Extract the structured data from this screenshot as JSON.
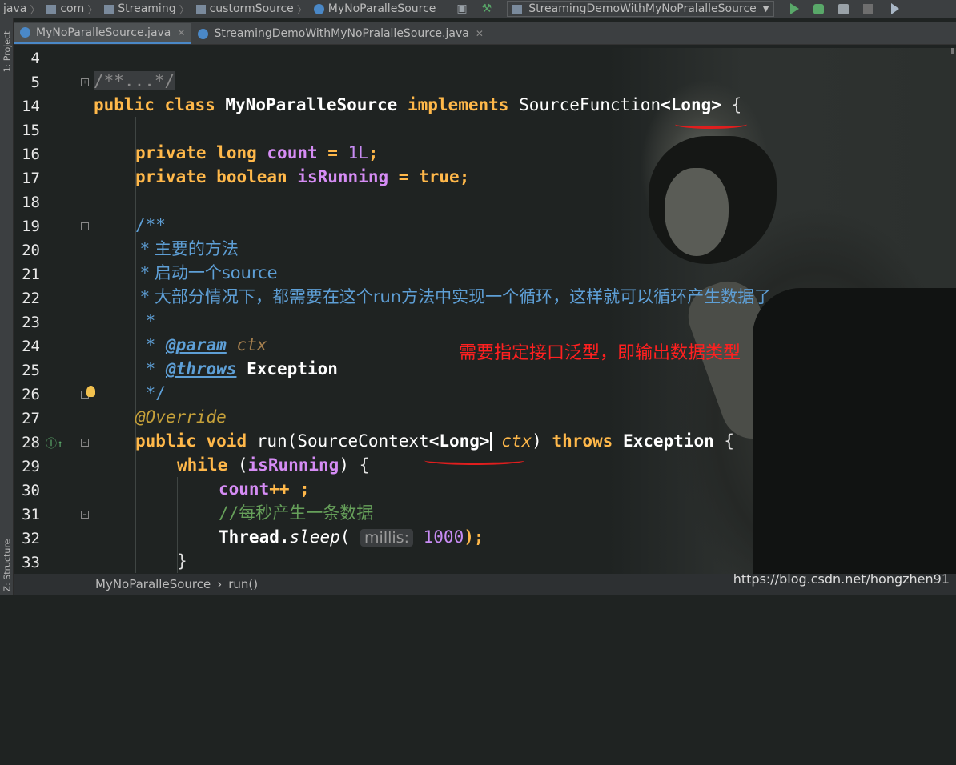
{
  "breadcrumb": [
    "java",
    "com",
    "Streaming",
    "custormSource",
    "MyNoParalleSource"
  ],
  "run_config": "StreamingDemoWithMyNoPralalleSource",
  "side_tools": {
    "project": "1: Project",
    "structure": "Z: Structure"
  },
  "tabs": [
    {
      "label": "MyNoParalleSource.java",
      "active": true
    },
    {
      "label": "StreamingDemoWithMyNoPralalleSource.java",
      "active": false
    }
  ],
  "line_numbers": [
    "4",
    "5",
    "14",
    "15",
    "16",
    "17",
    "18",
    "19",
    "20",
    "21",
    "22",
    "23",
    "24",
    "25",
    "26",
    "27",
    "28",
    "29",
    "30",
    "31",
    "32",
    "33"
  ],
  "code": {
    "l5": "/**...*/",
    "l14_kw1": "public",
    "l14_kw2": "class",
    "l14_name": "MyNoParalleSource",
    "l14_kw3": "implements",
    "l14_iface": "SourceFunction",
    "l14_type": "<Long>",
    "l14_brace": "{",
    "l16_kw1": "private",
    "l16_kw2": "long",
    "l16_field": "count",
    "l16_eq": "=",
    "l16_val": "1L",
    "l16_semi": ";",
    "l17_kw1": "private",
    "l17_kw2": "boolean",
    "l17_field": "isRunning",
    "l17_eq": "=",
    "l17_val": "true",
    "l17_semi": ";",
    "l19": "/**",
    "l20": " * 主要的方法",
    "l21": " * 启动一个source",
    "l22": " * 大部分情况下，都需要在这个run方法中实现一个循环，这样就可以循环产生数据了",
    "l23": " *",
    "l24_star": " * ",
    "l24_tag": "@param",
    "l24_name": "ctx",
    "l25_star": " * ",
    "l25_tag": "@throws",
    "l25_name": "Exception",
    "l26": " */",
    "l27": "@Override",
    "l28_kw1": "public",
    "l28_kw2": "void",
    "l28_method": "run(SourceContext",
    "l28_type": "<Long>",
    "l28_param": "ctx",
    "l28_paren": ")",
    "l28_kw3": "throws",
    "l28_exc": "Exception",
    "l28_brace": "{",
    "l29_kw": "while",
    "l29_open": "(",
    "l29_field": "isRunning",
    "l29_close": ")",
    "l29_brace": "{",
    "l30_field": "count",
    "l30_op": "++ ;",
    "l31": "//每秒产生一条数据",
    "l32_cls": "Thread.",
    "l32_method": "sleep",
    "l32_open": "(",
    "l32_hint": "millis:",
    "l32_val": "1000",
    "l32_close": ");",
    "l33": "}"
  },
  "annotation": "需要指定接口泛型，即输出数据类型",
  "status": {
    "class": "MyNoParalleSource",
    "sep": "›",
    "method": "run()"
  },
  "watermark": "https://blog.csdn.net/hongzhen91",
  "colors": {
    "keyword": "#ffb84a",
    "field": "#d58cf4",
    "doc": "#5e9fd6",
    "comment": "#66a05a",
    "annotation_red": "#ff2020"
  }
}
